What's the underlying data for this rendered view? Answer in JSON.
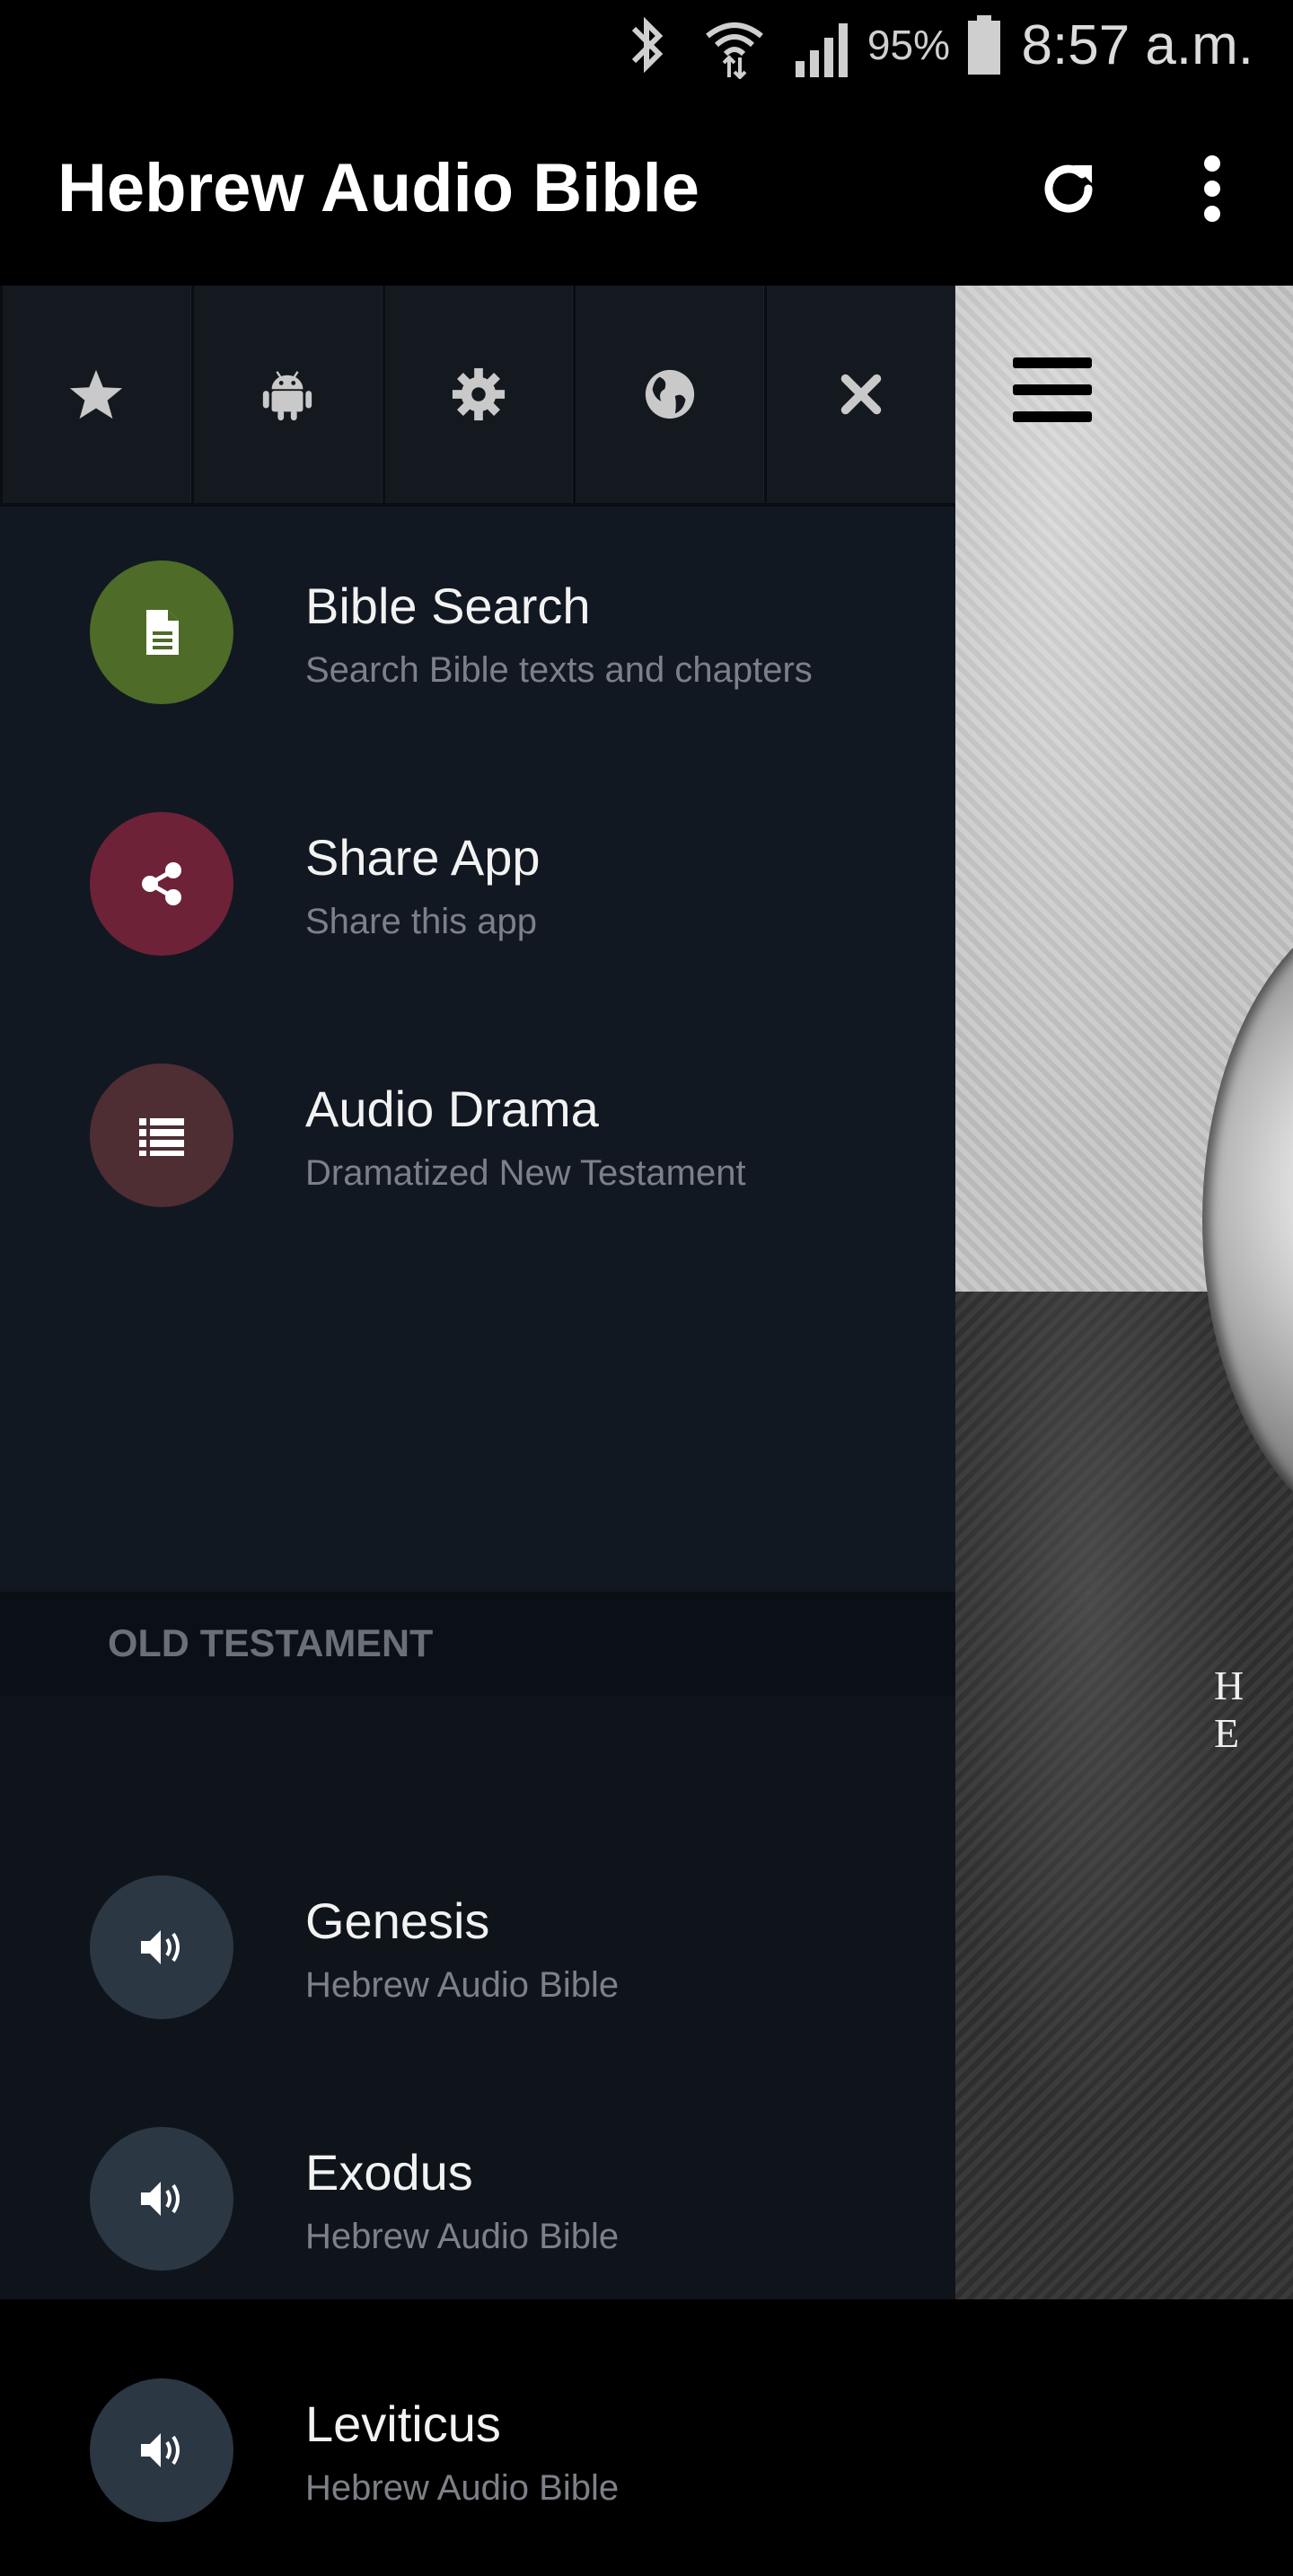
{
  "status_bar": {
    "battery_percent": "95%",
    "time": "8:57 a.m.",
    "icons": [
      "bluetooth-icon",
      "wifi-icon",
      "signal-icon",
      "battery-icon"
    ]
  },
  "app_bar": {
    "title": "Hebrew Audio Bible",
    "actions": [
      "refresh-icon",
      "overflow-menu-icon"
    ]
  },
  "drawer": {
    "toolbar": [
      "star-icon",
      "android-icon",
      "gear-icon",
      "globe-icon",
      "close-icon"
    ],
    "items": [
      {
        "title": "Bible Search",
        "subtitle": "Search Bible texts and chapters",
        "icon": "document-icon",
        "color": "#4e6b27"
      },
      {
        "title": "Share App",
        "subtitle": "Share this app",
        "icon": "share-icon",
        "color": "#6e2237"
      },
      {
        "title": "Audio Drama",
        "subtitle": "Dramatized New Testament",
        "icon": "list-icon",
        "color": "#4e2d33"
      }
    ],
    "section_header": "OLD TESTAMENT",
    "books": [
      {
        "title": "Genesis",
        "subtitle": "Hebrew Audio Bible",
        "icon": "speaker-icon",
        "color": "#2b3743"
      },
      {
        "title": "Exodus",
        "subtitle": "Hebrew Audio Bible",
        "icon": "speaker-icon",
        "color": "#2b3743"
      },
      {
        "title": "Leviticus",
        "subtitle": "Hebrew Audio Bible",
        "icon": "speaker-icon",
        "color": "#2b3743"
      }
    ]
  },
  "background": {
    "partial_text": "H E"
  }
}
